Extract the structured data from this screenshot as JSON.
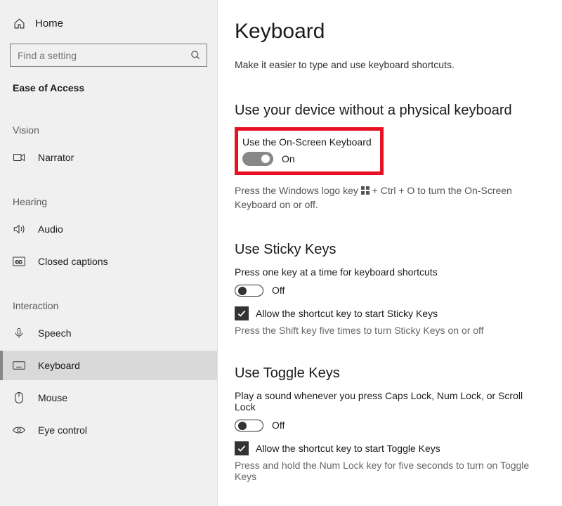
{
  "sidebar": {
    "home": "Home",
    "search_placeholder": "Find a setting",
    "groupTitle": "Ease of Access",
    "cat_vision": "Vision",
    "cat_hearing": "Hearing",
    "cat_interaction": "Interaction",
    "items": {
      "narrator": "Narrator",
      "audio": "Audio",
      "cc": "Closed captions",
      "speech": "Speech",
      "keyboard": "Keyboard",
      "mouse": "Mouse",
      "eye": "Eye control"
    }
  },
  "page": {
    "title": "Keyboard",
    "subtitle": "Make it easier to type and use keyboard shortcuts.",
    "osk": {
      "heading": "Use your device without a physical keyboard",
      "label": "Use the On-Screen Keyboard",
      "state": "On",
      "help_pre": "Press the Windows logo key ",
      "help_post": " + Ctrl + O to turn the On-Screen Keyboard on or off."
    },
    "sticky": {
      "heading": "Use Sticky Keys",
      "lead": "Press one key at a time for keyboard shortcuts",
      "state": "Off",
      "checkbox": "Allow the shortcut key to start Sticky Keys",
      "help": "Press the Shift key five times to turn Sticky Keys on or off"
    },
    "togglek": {
      "heading": "Use Toggle Keys",
      "lead": "Play a sound whenever you press Caps Lock, Num Lock, or Scroll Lock",
      "state": "Off",
      "checkbox": "Allow the shortcut key to start Toggle Keys",
      "help": "Press and hold the Num Lock key for five seconds to turn on Toggle Keys"
    }
  }
}
